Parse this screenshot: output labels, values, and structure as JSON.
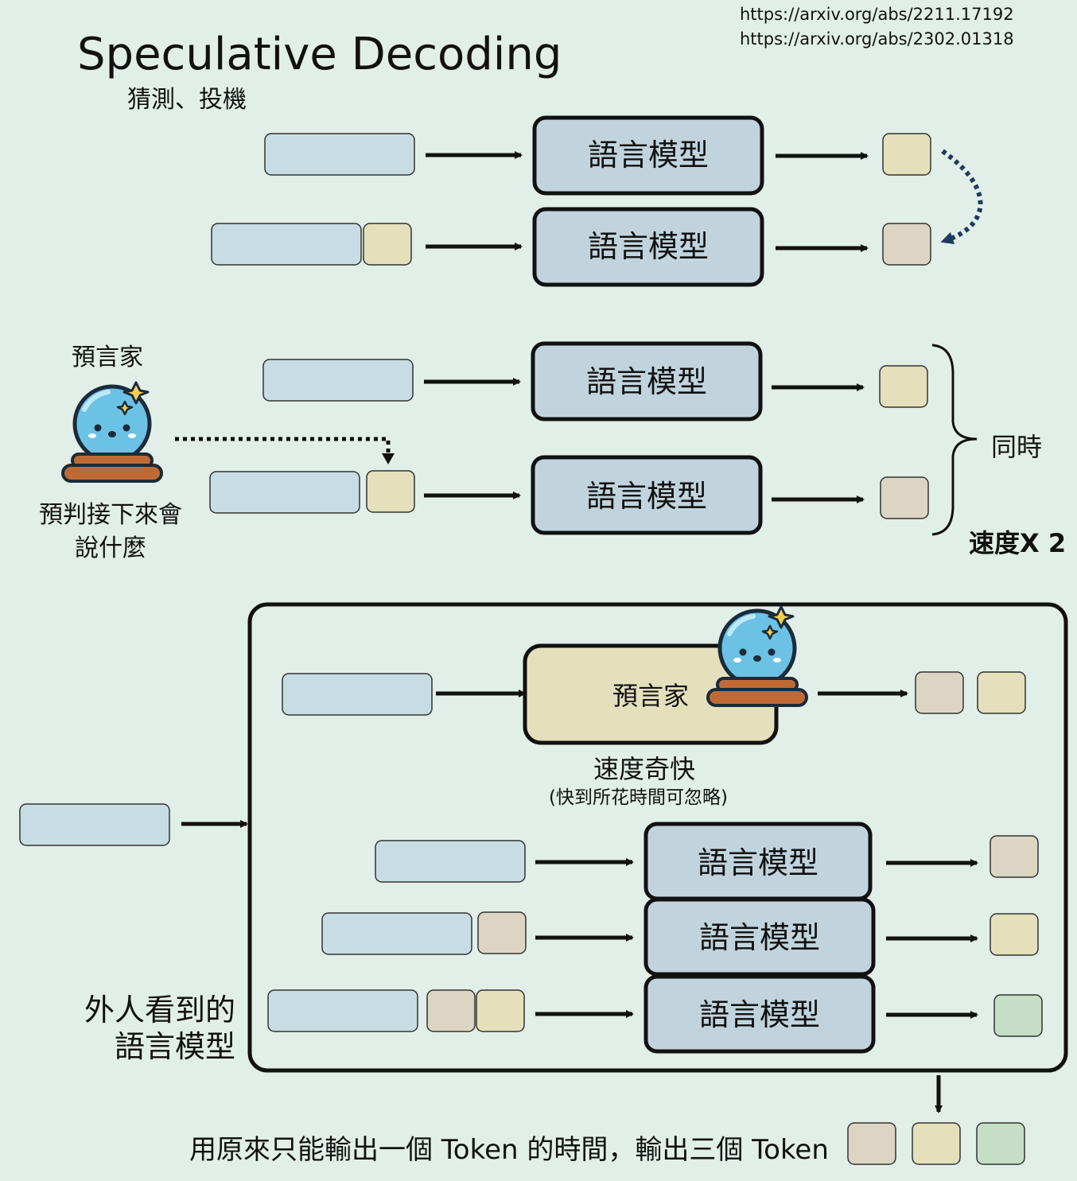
{
  "title": "Speculative Decoding",
  "subtitle": "猜測、投機",
  "references": [
    "https://arxiv.org/abs/2211.17192",
    "https://arxiv.org/abs/2302.01318"
  ],
  "lm_label": "語言模型",
  "prophet": {
    "title": "預言家",
    "description": "預判接下來會說什麼"
  },
  "parallel": {
    "same_time": "同時",
    "speedup": "速度X 2"
  },
  "draft_model": {
    "label": "預言家",
    "speed": "速度奇快",
    "speed_note": "(快到所花時間可忽略)"
  },
  "outsider_label": "外人看到的語言模型",
  "footer": "用原來只能輸出一個 Token 的時間，輸出三個 Token",
  "colors": {
    "background": "#e2efe8",
    "prompt_token": "#c8dde3",
    "token_yellow": "#e3e0bb",
    "token_beige": "#ddd5c3",
    "token_green": "#c5dec5",
    "model_box": "#c1d4dd",
    "draft_box": "#e4e0bc",
    "arrow": "#111111",
    "dotted_curve": "#1f3a5c"
  }
}
